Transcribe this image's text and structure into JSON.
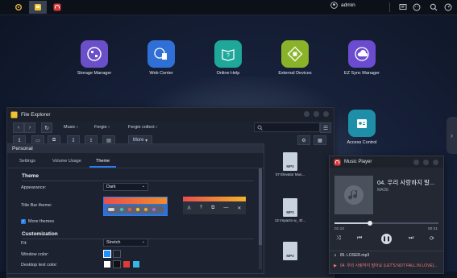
{
  "taskbar": {
    "user_label": "admin",
    "apps": [
      "gear-icon",
      "folder-icon",
      "headphones-icon"
    ]
  },
  "desktop": {
    "icons": [
      {
        "label": "Storage Manager",
        "color": "#6a4fc9"
      },
      {
        "label": "Web Center",
        "color": "#2f6fd6"
      },
      {
        "label": "Online Help",
        "color": "#1fa79a"
      },
      {
        "label": "External Devices",
        "color": "#8bb32a"
      },
      {
        "label": "EZ Sync Manager",
        "color": "#6b4ccf"
      },
      {
        "label": "Access Control",
        "color": "#1f8ea8"
      }
    ]
  },
  "file_explorer": {
    "title": "File Explorer",
    "breadcrumbs": [
      "Music",
      "Fergie",
      "Fergie collect"
    ],
    "more_label": "More",
    "files": [
      {
        "badge": "MP3",
        "name": "07 Elevator Mus..."
      },
      {
        "badge": "MP3",
        "name": "12 Impacto w_ El..."
      },
      {
        "badge": "MP3",
        "name": ""
      },
      {
        "badge": "",
        "name": ""
      }
    ]
  },
  "personal": {
    "title": "Personal",
    "tabs": [
      "Settings",
      "Volume Usage",
      "Theme"
    ],
    "active_tab": "Theme",
    "theme_section": "Theme",
    "appearance_label": "Appearance:",
    "appearance_value": "Dark",
    "title_bar_label": "Title Bar theme:",
    "more_themes_label": "More themes",
    "customization_section": "Customization",
    "fit_label": "Fit:",
    "fit_value": "Stretch",
    "window_color_label": "Window color:",
    "desktop_text_label": "Desktop text color:",
    "colors": {
      "accent": "#2b7de9",
      "window_swatches": [
        "#1e90ff",
        "#1b1f29"
      ],
      "text_swatches": [
        "#ffffff",
        "#111111",
        "#e03b3b",
        "#35b6e6"
      ]
    }
  },
  "music_player": {
    "title": "Music Player",
    "song": "04. 우리 사랑하지 말...",
    "artist": "MADE",
    "time_current": "01:10",
    "time_total": "00:31",
    "progress": 0.34,
    "playlist": [
      {
        "label": "05. LOSER.mp3"
      },
      {
        "label": "04. 우리 사랑하지 말아요 (LET'S NOT FALL IN LOVE)..."
      }
    ]
  }
}
